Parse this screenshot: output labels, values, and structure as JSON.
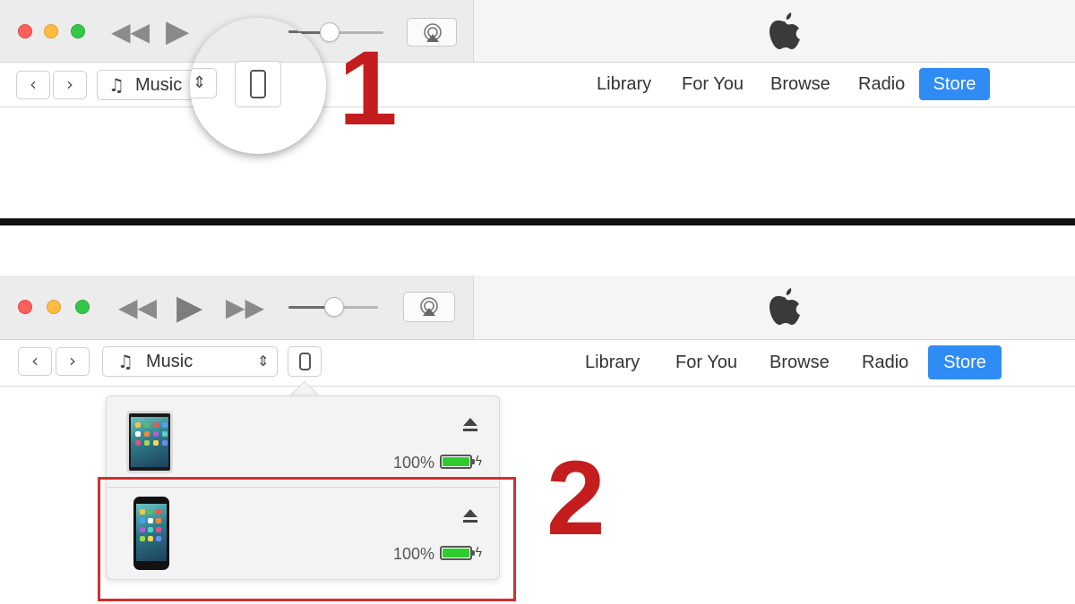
{
  "window": {
    "title_logo": "apple-logo-icon",
    "traffic_lights": [
      "close",
      "minimize",
      "zoom"
    ],
    "colors": {
      "close": "#fc605c",
      "minimize": "#fdbc40",
      "zoom": "#34c84a",
      "store_accent": "#2f8cf5",
      "callout_red": "#c41d1d",
      "battery_green": "#2ccd2c"
    }
  },
  "toolbar": {
    "back_icon": "chevron-left-icon",
    "forward_icon": "chevron-right-icon",
    "media_kind": "Music",
    "media_kind_icon": "music-note-icon",
    "device_icon": "iphone-icon",
    "tabs": [
      {
        "label": "Library"
      },
      {
        "label": "For You"
      },
      {
        "label": "Browse"
      },
      {
        "label": "Radio"
      },
      {
        "label": "Store",
        "selected": true
      }
    ]
  },
  "playback": {
    "rewind_icon": "rewind-icon",
    "play_icon": "play-icon",
    "forward_icon": "fast-forward-icon",
    "airplay_icon": "airplay-icon",
    "volume_level": 0.45
  },
  "callouts": {
    "step1": "1",
    "step2": "2"
  },
  "device_popover": {
    "devices": [
      {
        "kind": "iPad",
        "icon": "ipad-icon",
        "battery_percent": "100%",
        "battery_level": 1.0,
        "charging": true,
        "eject_icon": "eject-icon"
      },
      {
        "kind": "iPhone",
        "icon": "iphone-icon",
        "battery_percent": "100%",
        "battery_level": 1.0,
        "charging": true,
        "eject_icon": "eject-icon",
        "highlighted": true
      }
    ]
  }
}
